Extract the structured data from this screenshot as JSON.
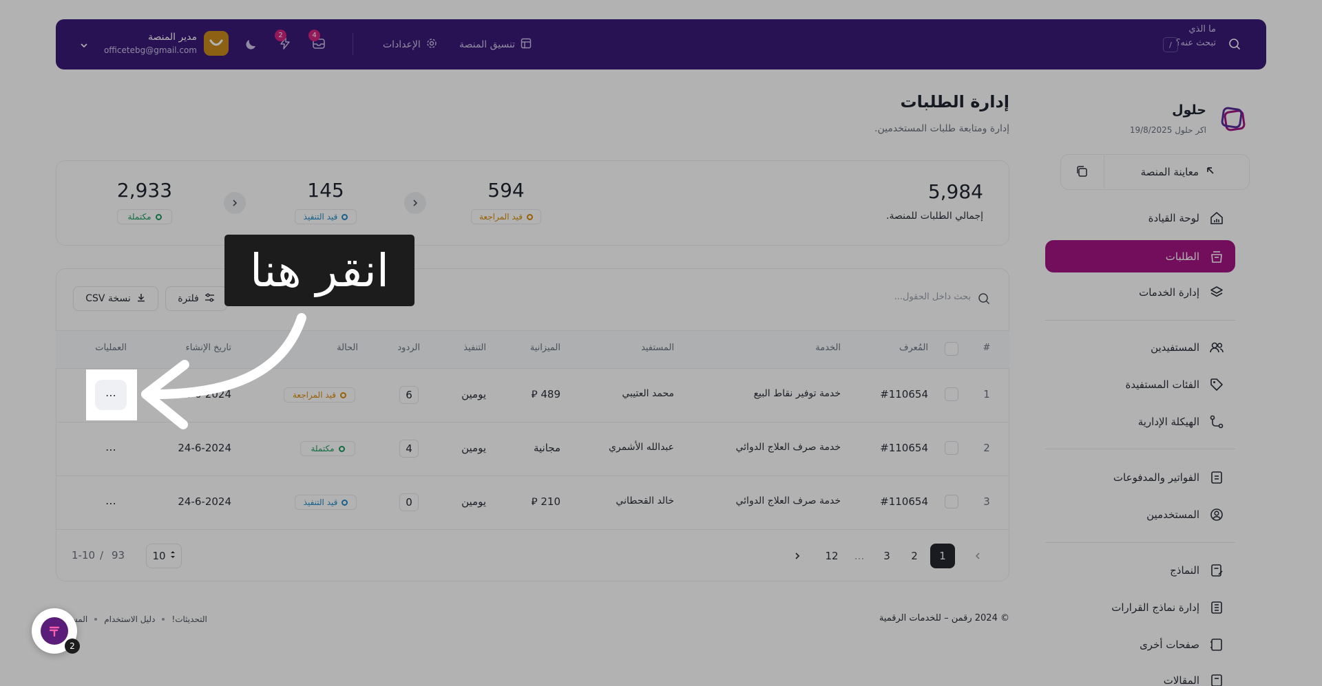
{
  "topbar": {
    "search_placeholder": "ما الذي تبحث عنه؟",
    "search_shortcut": "/",
    "nav_items": [
      "تنسيق المنصة",
      "الإعدادات"
    ],
    "messages_count": "4",
    "notifications_count": "2",
    "user_name": "مدير المنصة",
    "user_email": "officetebg@gmail.com"
  },
  "sidebar": {
    "brand_name": "حلول",
    "brand_date": "اكر حلول 19/8/2025",
    "preview_label": "معاينة المنصة",
    "items": [
      {
        "label": "لوحة القيادة",
        "icon": "home-icon"
      },
      {
        "label": "الطلبات",
        "icon": "inbox-icon"
      },
      {
        "label": "إدارة الخدمات",
        "icon": "layers-icon"
      },
      {
        "label": "المستفيدين",
        "icon": "users-icon"
      },
      {
        "label": "الفئات المستفيدة",
        "icon": "tag-icon"
      },
      {
        "label": "الهيكلة الإدارية",
        "icon": "hierarchy-icon"
      },
      {
        "label": "الفواتير والمدفوعات",
        "icon": "invoice-icon"
      },
      {
        "label": "المستخدمين",
        "icon": "user-circle-icon"
      },
      {
        "label": "النماذج",
        "icon": "form-icon"
      },
      {
        "label": "إدارة نماذج القرارات",
        "icon": "list-icon"
      },
      {
        "label": "صفحات أخرى",
        "icon": "pages-icon"
      },
      {
        "label": "المقالات",
        "icon": "article-icon"
      }
    ]
  },
  "page": {
    "title": "إدارة الطلبات",
    "subtitle": "إدارة ومتابعة طلبات المستخدمين."
  },
  "stats": {
    "total_value": "5,984",
    "total_label": "إجمالي الطلبات للمنصة.",
    "items": [
      {
        "value": "594",
        "label": "قيد المراجعة"
      },
      {
        "value": "145",
        "label": "قيد التنفيذ"
      },
      {
        "value": "2,933",
        "label": "مكتملة"
      }
    ]
  },
  "toolbar": {
    "search_placeholder": "بحث داخل الحقول...",
    "filter_label": "فلترة",
    "csv_label": "نسخة CSV"
  },
  "table": {
    "headers": [
      "#",
      "المُعرف",
      "الخدمة",
      "المستفيد",
      "الميزانية",
      "التنفيذ",
      "الردود",
      "الحالة",
      "تاريخ الإنشاء",
      "العمليات"
    ],
    "rows": [
      {
        "index": "1",
        "id": "#110654",
        "service": "خدمة توفير نقاط البيع",
        "beneficiary": "محمد العتيبي",
        "budget": "489 ⃁",
        "execution": "يومين",
        "replies": "6",
        "status": "قيد المراجعة",
        "date": "24-6-2024"
      },
      {
        "index": "2",
        "id": "#110654",
        "service": "خدمة صرف العلاج الدوائي",
        "beneficiary": "عبدالله الأشمري",
        "budget": "مجانية",
        "execution": "يومين",
        "replies": "4",
        "status": "مكتملة",
        "date": "24-6-2024"
      },
      {
        "index": "3",
        "id": "#110654",
        "service": "خدمة صرف العلاج الدوائي",
        "beneficiary": "خالد القحطاني",
        "budget": "210 ⃁",
        "execution": "يومين",
        "replies": "0",
        "status": "قيد التنفيذ",
        "date": "24-6-2024"
      }
    ]
  },
  "pagination": {
    "pages": [
      "1",
      "2",
      "3",
      "...",
      "12"
    ],
    "page_size": "10",
    "range": "1-10",
    "separator": "/",
    "total": "93"
  },
  "footer": {
    "copyright": "© 2024 رقمن – للخدمات الرقمية",
    "links": [
      "التحديثات!",
      "دليل الاستخدام",
      "المس"
    ]
  },
  "tutorial": {
    "callout_text": "انقر هنا",
    "chat_badge": "2"
  },
  "colors": {
    "topbar": "#3a1a78",
    "accent": "#a51586",
    "review": "#d98a07",
    "progress": "#1f8bc9",
    "done": "#1a9b5c"
  }
}
